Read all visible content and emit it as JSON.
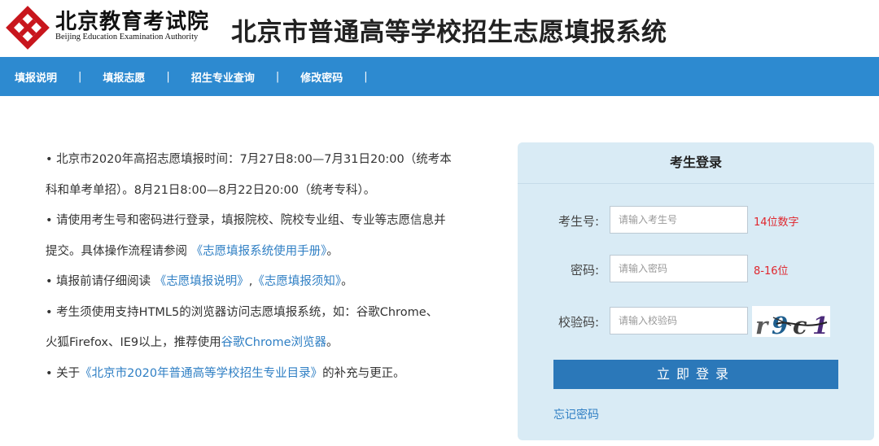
{
  "header": {
    "org_name_cn": "北京教育考试院",
    "org_name_en": "Beijing Education Examination Authority",
    "site_title": "北京市普通高等学校招生志愿填报系统",
    "logo_icon": "beijing-education-exam-logo",
    "brand_color": "#c8161d"
  },
  "nav": {
    "color": "#2d8ad0",
    "items": [
      {
        "label": "填报说明"
      },
      {
        "label": "填报志愿"
      },
      {
        "label": "招生专业查询"
      },
      {
        "label": "修改密码"
      }
    ],
    "separator": "|"
  },
  "notice": {
    "line1": "• 北京市2020年高招志愿填报时间：7月27日8:00—7月31日20:00（统考本",
    "line2": "科和单考单招）。8月21日8:00—8月22日20:00（统考专科）。",
    "line3": "• 请使用考生号和密码进行登录，填报院校、院校专业组、专业等志愿信息并",
    "line4_prefix": "提交。具体操作流程请参阅 ",
    "line4_link": "《志愿填报系统使用手册》",
    "line4_suffix": "。",
    "line5_prefix": "• 填报前请仔细阅读 ",
    "line5_link1": "《志愿填报说明》",
    "line5_mid": ",",
    "line5_link2": "《志愿填报须知》",
    "line5_suffix": "。",
    "line6": "• 考生须使用支持HTML5的浏览器访问志愿填报系统，如：谷歌Chrome、",
    "line7_prefix": "火狐Firefox、IE9以上，推荐使用",
    "line7_link": "谷歌Chrome浏览器",
    "line7_suffix": "。",
    "line8_prefix": "• 关于",
    "line8_link": "《北京市2020年普通高等学校招生专业目录》",
    "line8_suffix": "的补充与更正。"
  },
  "login": {
    "title": "考生登录",
    "exam_id_label": "考生号:",
    "exam_id_placeholder": "请输入考生号",
    "exam_id_hint": "14位数字",
    "password_label": "密码:",
    "password_placeholder": "请输入密码",
    "password_hint": "8-16位",
    "captcha_label": "校验码:",
    "captcha_placeholder": "请输入校验码",
    "captcha_text": "r9c1",
    "login_button": "立即登录",
    "forgot_password": "忘记密码",
    "button_color": "#2b78b9",
    "hint_color": "#e0262d"
  }
}
